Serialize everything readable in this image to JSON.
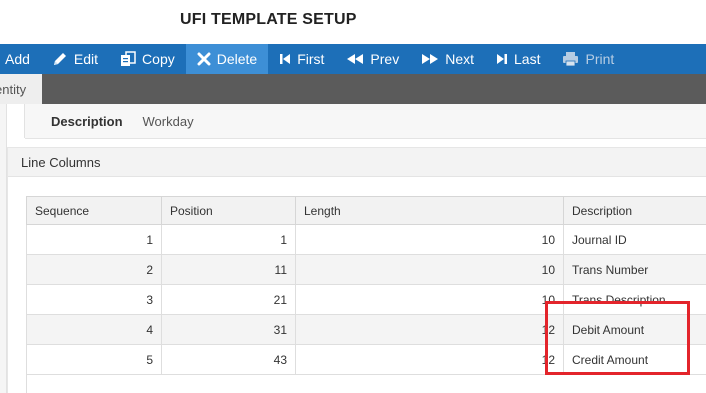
{
  "page": {
    "title": "UFI TEMPLATE SETUP"
  },
  "toolbar": {
    "add": "Add",
    "edit": "Edit",
    "copy": "Copy",
    "delete": "Delete",
    "first": "First",
    "prev": "Prev",
    "next": "Next",
    "last": "Last",
    "print": "Print",
    "active_button": "Delete",
    "disabled_button": "Print"
  },
  "tabs": {
    "current": "entity"
  },
  "header_fields": {
    "description_label": "Description",
    "description_value": "Workday"
  },
  "section": {
    "title": "Line Columns"
  },
  "grid": {
    "columns": [
      "Sequence",
      "Position",
      "Length",
      "Description"
    ],
    "rows": [
      {
        "sequence": "1",
        "position": "1",
        "length": "10",
        "description": "Journal ID"
      },
      {
        "sequence": "2",
        "position": "11",
        "length": "10",
        "description": "Trans Number"
      },
      {
        "sequence": "3",
        "position": "21",
        "length": "10",
        "description": "Trans Description"
      },
      {
        "sequence": "4",
        "position": "31",
        "length": "12",
        "description": "Debit Amount"
      },
      {
        "sequence": "5",
        "position": "43",
        "length": "12",
        "description": "Credit Amount"
      }
    ]
  },
  "colors": {
    "toolbar": "#1d6fb8",
    "toolbar_active": "#3d8fd6",
    "tabbar": "#5b5b5b",
    "highlight": "#e3242b"
  },
  "icons": {
    "edit": "pencil-icon",
    "copy": "copy-icon",
    "delete": "x-icon",
    "first": "skip-back-icon",
    "prev": "rewind-icon",
    "next": "fast-forward-icon",
    "last": "skip-forward-icon",
    "print": "printer-icon"
  }
}
